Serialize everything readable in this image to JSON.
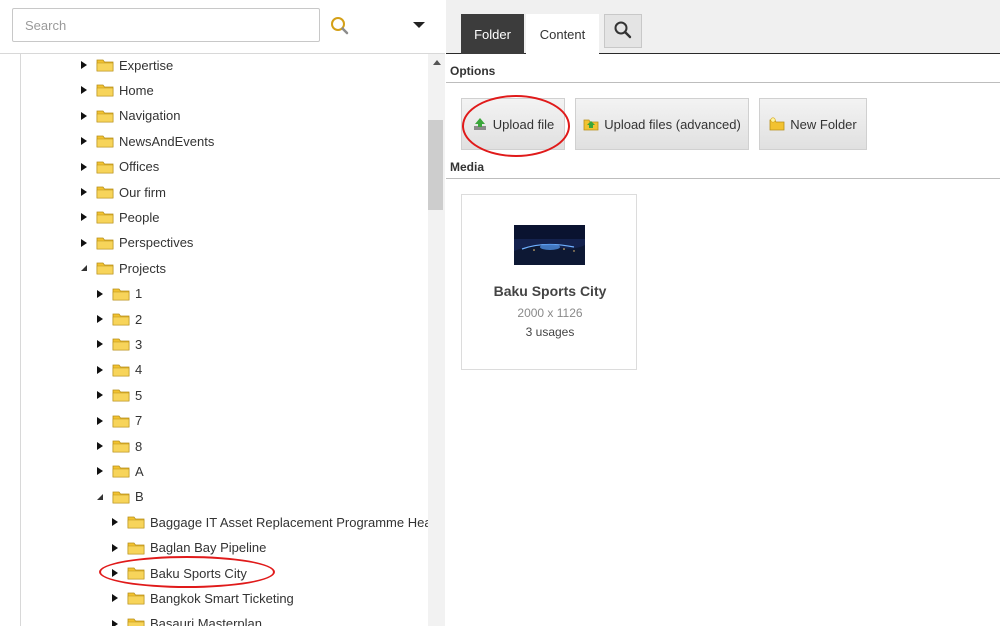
{
  "search": {
    "placeholder": "Search"
  },
  "tree": {
    "items": [
      {
        "label": "Expertise",
        "level": 1,
        "expanded": false
      },
      {
        "label": "Home",
        "level": 1,
        "expanded": false
      },
      {
        "label": "Navigation",
        "level": 1,
        "expanded": false
      },
      {
        "label": "NewsAndEvents",
        "level": 1,
        "expanded": false
      },
      {
        "label": "Offices",
        "level": 1,
        "expanded": false
      },
      {
        "label": "Our firm",
        "level": 1,
        "expanded": false
      },
      {
        "label": "People",
        "level": 1,
        "expanded": false
      },
      {
        "label": "Perspectives",
        "level": 1,
        "expanded": false
      },
      {
        "label": "Projects",
        "level": 1,
        "expanded": true
      },
      {
        "label": "1",
        "level": 2,
        "expanded": false
      },
      {
        "label": "2",
        "level": 2,
        "expanded": false
      },
      {
        "label": "3",
        "level": 2,
        "expanded": false
      },
      {
        "label": "4",
        "level": 2,
        "expanded": false
      },
      {
        "label": "5",
        "level": 2,
        "expanded": false
      },
      {
        "label": "7",
        "level": 2,
        "expanded": false
      },
      {
        "label": "8",
        "level": 2,
        "expanded": false
      },
      {
        "label": "A",
        "level": 2,
        "expanded": false
      },
      {
        "label": "B",
        "level": 2,
        "expanded": true
      },
      {
        "label": "Baggage IT Asset Replacement Programme Heathrc",
        "level": 3,
        "expanded": false
      },
      {
        "label": "Baglan Bay Pipeline",
        "level": 3,
        "expanded": false
      },
      {
        "label": "Baku Sports City",
        "level": 3,
        "expanded": false,
        "selected": true
      },
      {
        "label": "Bangkok Smart Ticketing",
        "level": 3,
        "expanded": false
      },
      {
        "label": "Basauri Masterplan",
        "level": 3,
        "expanded": false
      }
    ]
  },
  "tabs": {
    "folder": "Folder",
    "content": "Content"
  },
  "options": {
    "section_label": "Options",
    "upload_file": "Upload file",
    "upload_advanced": "Upload files (advanced)",
    "new_folder": "New Folder"
  },
  "media": {
    "section_label": "Media",
    "item": {
      "name": "Baku Sports City",
      "dimensions": "2000 x 1126",
      "usages": "3 usages"
    }
  },
  "colors": {
    "annotation": "#e01a1a",
    "active_tab": "#3c3c3c",
    "folder_icon": "#f2c230",
    "selection": "#d6e7f5"
  }
}
